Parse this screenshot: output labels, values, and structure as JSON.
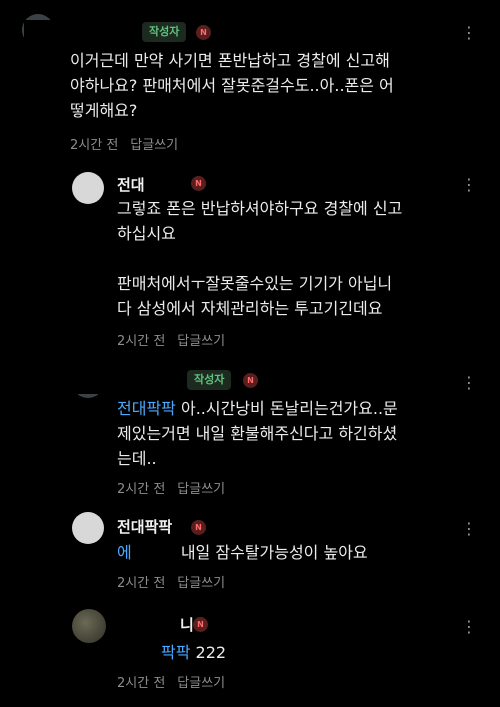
{
  "badges": {
    "author": "작성자",
    "new": "N"
  },
  "more_icon": "⋮",
  "comments": [
    {
      "author": "",
      "body": "이거근데 만약 사기면 폰반납하고 경찰에 신고해\n야하나요? 판매처에서 잘못준걸수도..아..폰은 어\n떻게해요?",
      "time": "2시간 전",
      "reply": "답글쓰기"
    },
    {
      "author": "전대",
      "body": "그렇죠 폰은 반납하셔야하구요 경찰에 신고\n하십시요\n\n판매처에서ㅜ잘못줄수있는 기기가 아닙니\n다 삼성에서 자체관리하는 투고기긴데요",
      "time": "2시간 전",
      "reply": "답글쓰기"
    },
    {
      "author": "",
      "mention": "전대팍팍",
      "body": " 아..시간낭비 돈날리는건가요..문\n제있는거면 내일 환불해주신다고 하긴하셨\n는데..",
      "time": "2시간 전",
      "reply": "답글쓰기"
    },
    {
      "author": "전대팍팍",
      "mention": "에",
      "body": " 내일 잠수탈가능성이 높아요",
      "time": "2시간 전",
      "reply": "답글쓰기"
    },
    {
      "author": "니",
      "mention": "팍팍",
      "body": " 222",
      "time": "2시간 전",
      "reply": "답글쓰기"
    }
  ],
  "colors": {
    "background": "#000000",
    "author_badge": "#5fc27e",
    "new_badge": "#ff6b6b",
    "mention": "#4aa8ff"
  }
}
